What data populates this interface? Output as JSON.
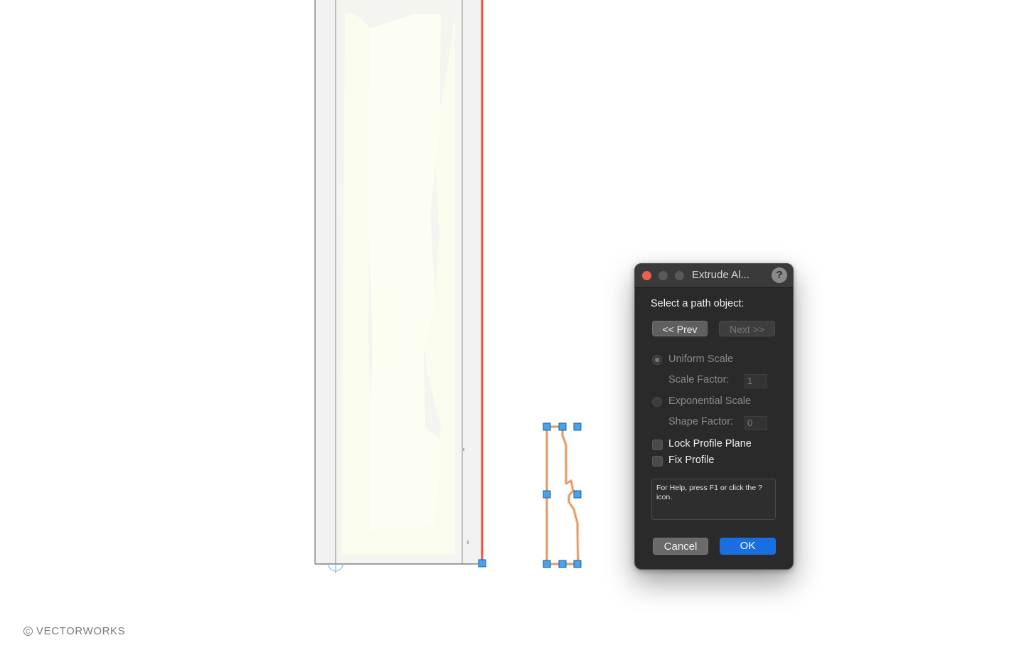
{
  "watermark": {
    "symbol": "C",
    "text": "VECTORWORKS"
  },
  "dialog": {
    "title": "Extrude Al...",
    "help_icon": "?",
    "prompt": "Select a path object:",
    "prev_label": "<< Prev",
    "next_label": "Next >>",
    "uniform_scale_label": "Uniform Scale",
    "uniform_scale_selected": true,
    "scale_factor_label": "Scale Factor:",
    "scale_factor_value": "1",
    "exponential_scale_label": "Exponential Scale",
    "shape_factor_label": "Shape Factor:",
    "shape_factor_value": "0",
    "lock_profile_plane_label": "Lock Profile Plane",
    "lock_profile_plane_checked": false,
    "fix_profile_label": "Fix Profile",
    "fix_profile_checked": false,
    "help_text": "For Help, press F1 or click the ? icon.",
    "cancel_label": "Cancel",
    "ok_label": "OK"
  },
  "colors": {
    "path_red": "#e8553e",
    "profile_orange": "#e07a4a",
    "handle_blue": "#4aa3e8",
    "ok_blue": "#1a6fe0",
    "traffic_close": "#ee5d50"
  },
  "icons": [
    "close-traffic-light",
    "minimize-traffic-light",
    "maximize-traffic-light",
    "help-icon",
    "radio-button",
    "checkbox"
  ]
}
